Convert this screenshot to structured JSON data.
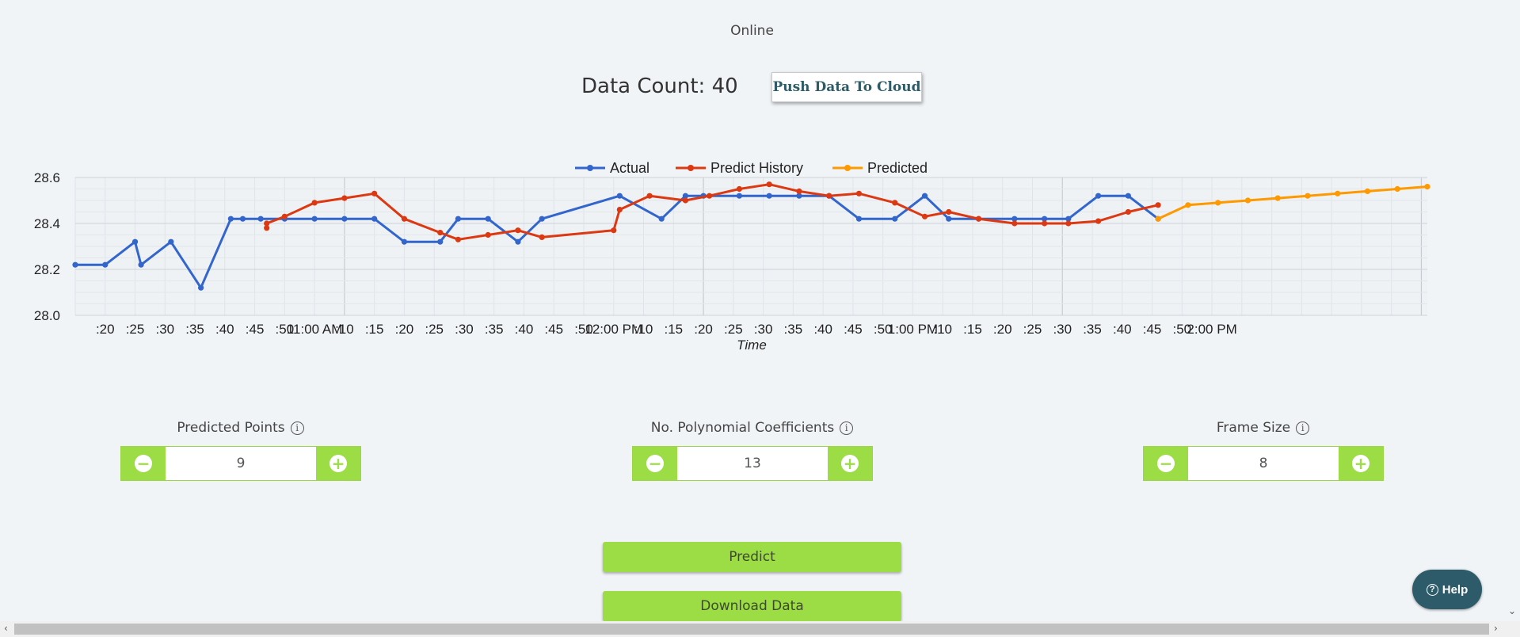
{
  "status": "Online",
  "data_count_label": "Data Count: 40",
  "push_button": "Push Data To Cloud",
  "chart_data": {
    "type": "line",
    "xlabel": "Time",
    "ylim": [
      28.0,
      28.6
    ],
    "yticks": [
      "28.0",
      "28.2",
      "28.4",
      "28.6"
    ],
    "xticks": [
      ":20",
      ":25",
      ":30",
      ":35",
      ":40",
      ":45",
      ":50",
      "11:00 AM",
      ":10",
      ":15",
      ":20",
      ":25",
      ":30",
      ":35",
      ":40",
      ":45",
      ":50",
      "12:00 PM",
      ":10",
      ":15",
      ":20",
      ":25",
      ":30",
      ":35",
      ":40",
      ":45",
      ":50",
      "1:00 PM",
      ":10",
      ":15",
      ":20",
      ":25",
      ":30",
      ":35",
      ":40",
      ":45",
      ":50",
      "2:00 PM"
    ],
    "xlim": [
      "10:15",
      "14:01"
    ],
    "grid": true,
    "legend_position": "top-center",
    "series": [
      {
        "name": "Actual",
        "color": "#3366cc",
        "points": [
          [
            "10:15",
            28.22
          ],
          [
            "10:20",
            28.22
          ],
          [
            "10:25",
            28.32
          ],
          [
            "10:26",
            28.22
          ],
          [
            "10:31",
            28.32
          ],
          [
            "10:36",
            28.12
          ],
          [
            "10:41",
            28.42
          ],
          [
            "10:43",
            28.42
          ],
          [
            "10:46",
            28.42
          ],
          [
            "10:50",
            28.42
          ],
          [
            "10:55",
            28.42
          ],
          [
            "11:00",
            28.42
          ],
          [
            "11:05",
            28.42
          ],
          [
            "11:10",
            28.32
          ],
          [
            "11:16",
            28.32
          ],
          [
            "11:19",
            28.42
          ],
          [
            "11:24",
            28.42
          ],
          [
            "11:29",
            28.32
          ],
          [
            "11:33",
            28.42
          ],
          [
            "11:46",
            28.52
          ],
          [
            "11:53",
            28.42
          ],
          [
            "11:57",
            28.52
          ],
          [
            "12:00",
            28.52
          ],
          [
            "12:06",
            28.52
          ],
          [
            "12:11",
            28.52
          ],
          [
            "12:16",
            28.52
          ],
          [
            "12:21",
            28.52
          ],
          [
            "12:26",
            28.42
          ],
          [
            "12:32",
            28.42
          ],
          [
            "12:37",
            28.52
          ],
          [
            "12:41",
            28.42
          ],
          [
            "12:46",
            28.42
          ],
          [
            "12:52",
            28.42
          ],
          [
            "12:57",
            28.42
          ],
          [
            "13:01",
            28.42
          ],
          [
            "13:06",
            28.52
          ],
          [
            "13:11",
            28.52
          ],
          [
            "13:16",
            28.42
          ]
        ]
      },
      {
        "name": "Predict History",
        "color": "#dc3912",
        "points": [
          [
            "10:47",
            28.38
          ],
          [
            "10:47",
            28.4
          ],
          [
            "10:50",
            28.43
          ],
          [
            "10:55",
            28.49
          ],
          [
            "11:00",
            28.51
          ],
          [
            "11:05",
            28.53
          ],
          [
            "11:10",
            28.42
          ],
          [
            "11:16",
            28.36
          ],
          [
            "11:19",
            28.33
          ],
          [
            "11:24",
            28.35
          ],
          [
            "11:29",
            28.37
          ],
          [
            "11:33",
            28.34
          ],
          [
            "11:45",
            28.37
          ],
          [
            "11:46",
            28.46
          ],
          [
            "11:51",
            28.52
          ],
          [
            "11:57",
            28.5
          ],
          [
            "12:01",
            28.52
          ],
          [
            "12:06",
            28.55
          ],
          [
            "12:11",
            28.57
          ],
          [
            "12:16",
            28.54
          ],
          [
            "12:21",
            28.52
          ],
          [
            "12:26",
            28.53
          ],
          [
            "12:32",
            28.49
          ],
          [
            "12:37",
            28.43
          ],
          [
            "12:41",
            28.45
          ],
          [
            "12:46",
            28.42
          ],
          [
            "12:52",
            28.4
          ],
          [
            "12:57",
            28.4
          ],
          [
            "13:01",
            28.4
          ],
          [
            "13:06",
            28.41
          ],
          [
            "13:11",
            28.45
          ],
          [
            "13:16",
            28.48
          ]
        ]
      },
      {
        "name": "Predicted",
        "color": "#ff9900",
        "points": [
          [
            "13:16",
            28.42
          ],
          [
            "13:21",
            28.48
          ],
          [
            "13:26",
            28.49
          ],
          [
            "13:31",
            28.5
          ],
          [
            "13:36",
            28.51
          ],
          [
            "13:41",
            28.52
          ],
          [
            "13:46",
            28.53
          ],
          [
            "13:51",
            28.54
          ],
          [
            "13:56",
            28.55
          ],
          [
            "14:01",
            28.56
          ]
        ]
      }
    ]
  },
  "controls": [
    {
      "label": "Predicted Points",
      "value": "9"
    },
    {
      "label": "No. Polynomial Coefficients",
      "value": "13"
    },
    {
      "label": "Frame Size",
      "value": "8"
    }
  ],
  "predict_button": "Predict",
  "download_button": "Download Data",
  "help_button": "Help",
  "icons": {
    "info": "info-circle-icon",
    "minus": "minus-circle-icon",
    "plus": "plus-circle-icon",
    "help": "question-circle-icon"
  }
}
